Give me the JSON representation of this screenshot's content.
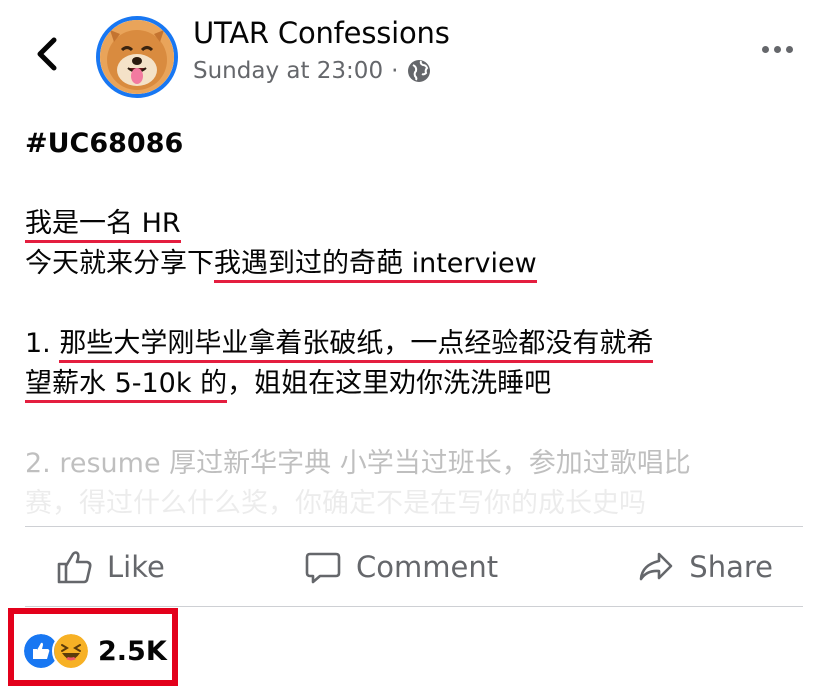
{
  "header": {
    "page_name": "UTAR Confessions",
    "timestamp": "Sunday at 23:00",
    "separator": "·",
    "privacy_icon": "globe-icon",
    "back_icon": "chevron-left-icon",
    "more_icon": "more-dots-icon"
  },
  "post": {
    "tag": "#UC68086",
    "line1": "我是一名 HR",
    "line2_plain": "今天就来分享下",
    "line2_marked": "我遇到过的奇葩 interview",
    "item1_prefix": "1. ",
    "item1_marked_a": "那些大学刚毕业拿着张破纸，一点经验都没有就希",
    "item1_marked_b": "望薪水 5-10k 的",
    "item1_rest": "，姐姐在这里劝你洗洗睡吧",
    "item2": "2. resume 厚过新华字典 小学当过班长，参加过歌唱比",
    "item2_cont": "赛，得过什么什么奖，你确定不是在写你的成长史吗"
  },
  "actions": {
    "like": "Like",
    "comment": "Comment",
    "share": "Share"
  },
  "reactions": {
    "count": "2.5K",
    "icons": [
      "like-reaction-icon",
      "haha-reaction-icon"
    ]
  },
  "colors": {
    "brand_blue": "#1877F2",
    "highlight_red": "#e41e3f",
    "box_red": "#e3001b",
    "secondary_text": "#65676b"
  }
}
